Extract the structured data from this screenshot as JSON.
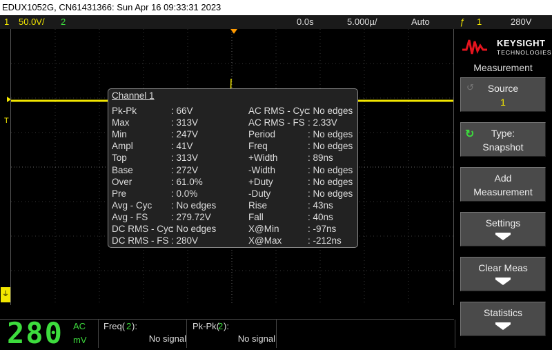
{
  "title_bar": "EDUX1052G, CN61431366: Sun Apr 16 09:33:31 2023",
  "status": {
    "ch1_num": "1",
    "ch1_scale": "50.0V/",
    "ch2_num": "2",
    "time_offset": "0.0s",
    "timebase": "5.000µ/",
    "trigger_mode": "Auto",
    "trigger_icon": "ƒ",
    "trigger_source": "1",
    "trigger_level": "280V"
  },
  "trigger_marker_label": "T",
  "measurement_box": {
    "title": "Channel 1",
    "left_col": [
      {
        "name": "Pk-Pk",
        "value": ": 66V"
      },
      {
        "name": "Max",
        "value": ": 313V"
      },
      {
        "name": "Min",
        "value": ": 247V"
      },
      {
        "name": "Ampl",
        "value": ": 41V"
      },
      {
        "name": "Top",
        "value": ": 313V"
      },
      {
        "name": "Base",
        "value": ": 272V"
      },
      {
        "name": "Over",
        "value": ": 61.0%"
      },
      {
        "name": "Pre",
        "value": ": 0.0%"
      },
      {
        "name": "Avg - Cyc",
        "value": ": No edges"
      },
      {
        "name": "Avg - FS",
        "value": ": 279.72V"
      },
      {
        "name": "DC RMS - Cyc",
        "value": ": No edges"
      },
      {
        "name": "DC RMS - FS",
        "value": ": 280V"
      }
    ],
    "right_col": [
      {
        "name": "AC RMS - Cyc",
        "value": ": No edges"
      },
      {
        "name": "AC RMS - FS",
        "value": ": 2.33V"
      },
      {
        "name": "Period",
        "value": ": No edges"
      },
      {
        "name": "Freq",
        "value": ": No edges"
      },
      {
        "name": "+Width",
        "value": ": 89ns"
      },
      {
        "name": "-Width",
        "value": ": No edges"
      },
      {
        "name": "+Duty",
        "value": ": No edges"
      },
      {
        "name": "-Duty",
        "value": ": No edges"
      },
      {
        "name": "Rise",
        "value": ": 43ns"
      },
      {
        "name": "Fall",
        "value": ": 40ns"
      },
      {
        "name": "X@Min",
        "value": ": -97ns"
      },
      {
        "name": "X@Max",
        "value": ": -212ns"
      }
    ]
  },
  "brand": {
    "name": "KEYSIGHT",
    "sub": "TECHNOLOGIES"
  },
  "side_menu": {
    "title": "Measurement",
    "keys": [
      {
        "l1": "Source",
        "l2": "1"
      },
      {
        "l1": "Type:",
        "l2": "Snapshot"
      },
      {
        "l1": "Add",
        "l2": "Measurement"
      },
      {
        "l1": "Settings"
      },
      {
        "l1": "Clear Meas"
      },
      {
        "l1": "Statistics"
      }
    ]
  },
  "bottom": {
    "digits": "280",
    "coupling": "AC",
    "unit": "mV",
    "m1_label": "Freq(",
    "m1_ch": "2",
    "m1_end": "):",
    "m1_value": "No signal",
    "m2_label": "Pk-Pk(",
    "m2_ch": "2",
    "m2_end": "):",
    "m2_value": "No signal"
  },
  "colors": {
    "ch1": "#f2e600",
    "ch2": "#3ddc3d",
    "trigger": "#ff9900"
  }
}
